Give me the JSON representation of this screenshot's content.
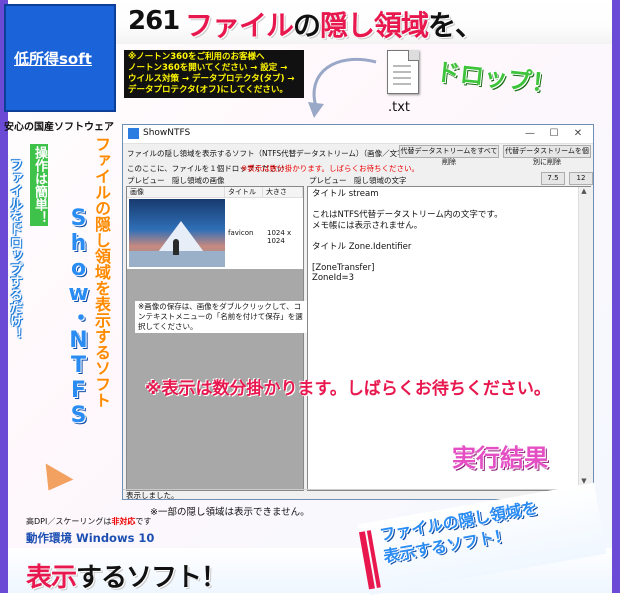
{
  "headline": {
    "number": "261",
    "text_red1": "ファイル",
    "text_black1": "の",
    "text_red2": "隠し領域",
    "text_black2": "を、"
  },
  "logo": {
    "text": "低所得soft",
    "subtitle": "安心の国産ソフトウェア"
  },
  "norton_note": {
    "lines": [
      "※ノートン360をご利用のお客様へ",
      "ノートン360を開いてください → 設定 →",
      "ウイルス対策 → データプロテクタ(タブ) →",
      "データプロテクタ(オフ)にしてください。"
    ]
  },
  "file_icon": {
    "label": ".txt"
  },
  "drop_label": "ドロップ！",
  "side_texts": {
    "simple": "操作は簡単！",
    "drop": "ファイルをドロップするだけ！",
    "hidden": "ファイルの隠し領域を表示するソフト",
    "show": "Show・NTFS"
  },
  "window": {
    "title": "ShowNTFS",
    "description": "ファイルの隠し領域を表示するソフト（NTFS代替データストリーム）（画像／文字）",
    "drop_hint": "このここに、ファイルを１個ドロップください",
    "drop_warning": "※表示は数分掛かります。しばらくお待ちください。",
    "buttons": {
      "delete_all": "代替データストリームをすべて削除",
      "delete_one": "代替データストリームを個別に削除",
      "zoom1": "7.5",
      "zoom2": "12"
    },
    "labels": {
      "preview_image": "プレビュー　隠し領域の画像",
      "preview_text": "プレビュー　隠し領域の文字"
    },
    "image_table": {
      "headers": [
        "画像",
        "タイトル",
        "大きさ"
      ],
      "rows": [
        {
          "title": "favicon",
          "size": "1024 x 1024"
        }
      ]
    },
    "image_note": "※画像の保存は、画像をダブルクリックして、コンテキストメニューの「名前を付けて保存」を選択してください。",
    "text_content": "タイトル stream\n\nこれはNTFS代替データストリーム内の文字です。\nメモ帳には表示されません。\n\nタイトル Zone.Identifier\n\n[ZoneTransfer]\nZoneId=3",
    "status": "表示しました。",
    "controls": {
      "minimize": "—",
      "maximize": "☐",
      "close": "✕"
    }
  },
  "overlays": {
    "wait": "※表示は数分掛かります。しばらくお待ちください。",
    "result": "実行結果"
  },
  "notes": {
    "partial": "※一部の隠し領域は表示できません。",
    "dpi_prefix": "高DPI／スケーリングは",
    "dpi_red": "非対応",
    "dpi_suffix": "です",
    "env": "動作環境 Windows 10"
  },
  "bottom": {
    "red": "表示",
    "black": "するソフト！"
  },
  "banner": {
    "line1": "ファイルの隠し領域を",
    "line2": "表示するソフト！"
  },
  "colors": {
    "accent_red": "#e8184f",
    "accent_blue": "#2a8cf2",
    "logo_blue": "#1a63d8",
    "drop_green": "#3ec43b",
    "frame_purple": "#6b4bd6"
  }
}
